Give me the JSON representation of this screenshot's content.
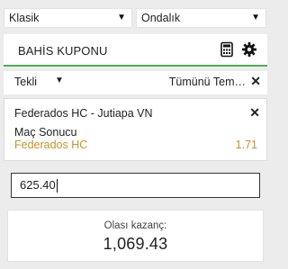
{
  "selects": {
    "bet_type": "Klasik",
    "odds_format": "Ondalık"
  },
  "coupon": {
    "title": "BAHİS KUPONU",
    "mode": "Tekli",
    "remove_all": "Tümünü Tem…"
  },
  "bet": {
    "match": "Federados HC - Jutiapa VN",
    "market": "Maç Sonucu",
    "selection": "Federados HC",
    "odds": "1.71"
  },
  "stake": {
    "value": "625.40"
  },
  "winnings": {
    "label": "Olası kazanç:",
    "amount": "1,069.43"
  },
  "colors": {
    "accent_green": "#4bb04f",
    "selection_gold": "#c8922a"
  },
  "icons": [
    "calculator-icon",
    "gear-icon",
    "close-icon",
    "caret-down-icon"
  ]
}
